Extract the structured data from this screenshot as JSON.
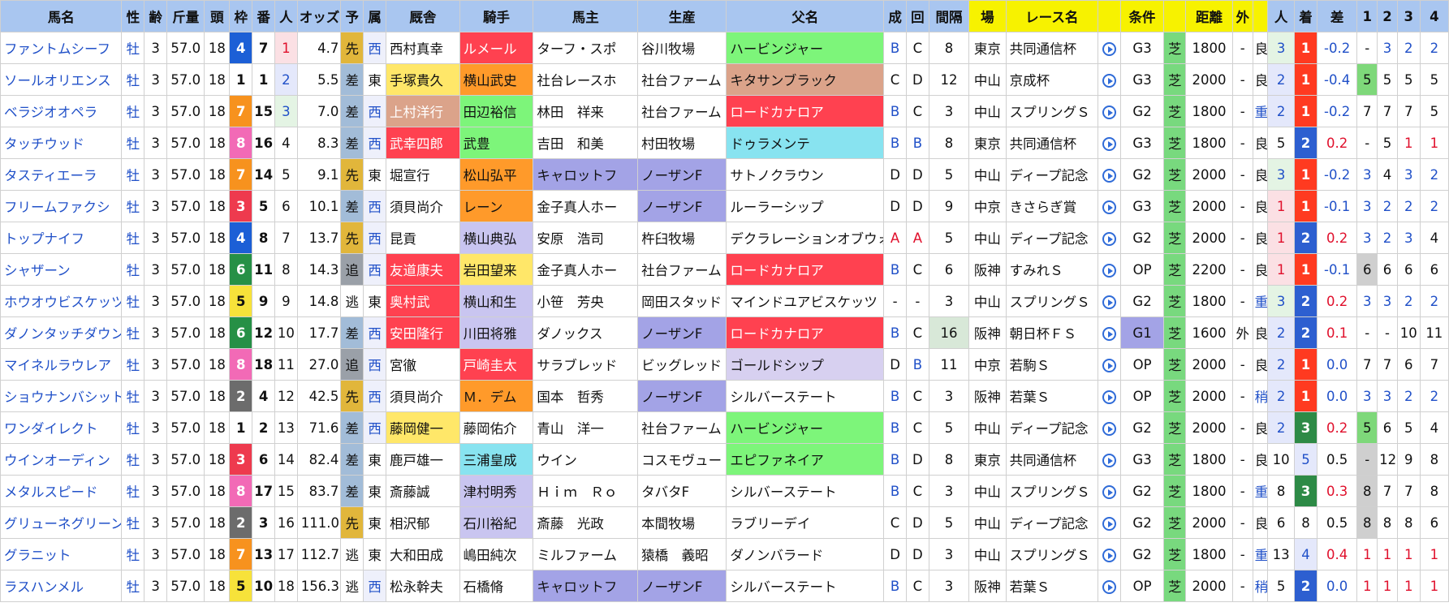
{
  "headers": [
    "馬名",
    "性",
    "齢",
    "斤量",
    "頭",
    "枠",
    "番",
    "人",
    "オッズ",
    "予",
    "属",
    "厩舎",
    "騎手",
    "馬主",
    "生産",
    "父名",
    "成",
    "回",
    "間隔",
    "場",
    "レース名",
    "",
    "条件",
    "",
    "距離",
    "外",
    "",
    "人",
    "着",
    "差",
    "1",
    "2",
    "3",
    "4"
  ],
  "colors": {
    "header": "#a9c6f0",
    "header_yellow": "#f7f200",
    "waku": {
      "1": "#ffffff",
      "2": "#6c6c6c",
      "3": "#ee3a4e",
      "4": "#1c5fd6",
      "5": "#f7e23a",
      "6": "#269046",
      "7": "#f7921e",
      "8": "#f26ab6"
    },
    "style": {
      "先": "#e1b63b",
      "差": "#a2bcd8",
      "追": "#9aa0a8",
      "逃": "#ffffff"
    },
    "group": {
      "G1": "#a3a3e6",
      "G2": "#ffffff",
      "G3": "#ffffff",
      "OP": "#ffffff"
    },
    "finish": {
      "1": "#ff3a20",
      "2": "#2d5fd0",
      "3": "#2d8a46",
      "4": "#ffffff",
      "5": "#ffffff",
      "8": "#ffffff"
    },
    "hl": {
      "red": "#ff4150",
      "orange": "#ff9a2a",
      "yellow": "#ffe769",
      "green": "#7df57a",
      "lavender": "#c9c5f0",
      "cyan": "#88e3f0",
      "purple": "#a3a3e6",
      "brown": "#dba38a",
      "gray": "#cfcfcf",
      "lightlav": "#d7d0f0"
    }
  },
  "rows": [
    {
      "name": "ファントムシーフ",
      "sex": "牡",
      "age": "3",
      "kin": "57.0",
      "tou": "18",
      "waku": "4",
      "ban": "7",
      "nin": "1",
      "odds": "4.7",
      "yo": "先",
      "zoku": "西",
      "kyusha": "西村真幸",
      "kishu": "ルメール",
      "banushi": "ターフ・スポ",
      "seisan": "谷川牧場",
      "chichi": "ハービンジャー",
      "sei": "B",
      "kai": "C",
      "kankaku": "8",
      "ba": "東京",
      "race": "共同通信杯",
      "joken": "G3",
      "shiba": "芝",
      "kyori": "1800",
      "soto": "-",
      "baba": "良",
      "rnin": "3",
      "chaku": "1",
      "sa": "-0.2",
      "c1": "-",
      "c2": "3",
      "c3": "2",
      "c4": "2",
      "kyusha_bg": "",
      "kishu_bg": "red",
      "banushi_bg": "",
      "seisan_bg": "",
      "chichi_bg": "green"
    },
    {
      "name": "ソールオリエンス",
      "sex": "牡",
      "age": "3",
      "kin": "57.0",
      "tou": "18",
      "waku": "1",
      "ban": "1",
      "nin": "2",
      "odds": "5.5",
      "yo": "差",
      "zoku": "東",
      "kyusha": "手塚貴久",
      "kishu": "横山武史",
      "banushi": "社台レースホ",
      "seisan": "社台ファーム",
      "chichi": "キタサンブラック",
      "sei": "C",
      "kai": "D",
      "kankaku": "12",
      "ba": "中山",
      "race": "京成杯",
      "joken": "G3",
      "shiba": "芝",
      "kyori": "2000",
      "soto": "-",
      "baba": "良",
      "rnin": "2",
      "chaku": "1",
      "sa": "-0.4",
      "c1": "5",
      "c2": "5",
      "c3": "5",
      "c4": "5",
      "kyusha_bg": "yellow",
      "kishu_bg": "orange",
      "banushi_bg": "",
      "seisan_bg": "",
      "chichi_bg": "brown"
    },
    {
      "name": "ベラジオオペラ",
      "sex": "牡",
      "age": "3",
      "kin": "57.0",
      "tou": "18",
      "waku": "7",
      "ban": "15",
      "nin": "3",
      "odds": "7.0",
      "yo": "差",
      "zoku": "西",
      "kyusha": "上村洋行",
      "kishu": "田辺裕信",
      "banushi": "林田　祥来",
      "seisan": "社台ファーム",
      "chichi": "ロードカナロア",
      "sei": "B",
      "kai": "C",
      "kankaku": "3",
      "ba": "中山",
      "race": "スプリングＳ",
      "joken": "G2",
      "shiba": "芝",
      "kyori": "1800",
      "soto": "-",
      "baba": "重",
      "rnin": "2",
      "chaku": "1",
      "sa": "-0.2",
      "c1": "7",
      "c2": "7",
      "c3": "7",
      "c4": "5",
      "kyusha_bg": "brown",
      "kishu_bg": "green",
      "banushi_bg": "",
      "seisan_bg": "",
      "chichi_bg": "red"
    },
    {
      "name": "タッチウッド",
      "sex": "牡",
      "age": "3",
      "kin": "57.0",
      "tou": "18",
      "waku": "8",
      "ban": "16",
      "nin": "4",
      "odds": "8.3",
      "yo": "差",
      "zoku": "西",
      "kyusha": "武幸四郎",
      "kishu": "武豊",
      "banushi": "吉田　和美",
      "seisan": "村田牧場",
      "chichi": "ドゥラメンテ",
      "sei": "B",
      "kai": "B",
      "kankaku": "8",
      "ba": "東京",
      "race": "共同通信杯",
      "joken": "G3",
      "shiba": "芝",
      "kyori": "1800",
      "soto": "-",
      "baba": "良",
      "rnin": "5",
      "chaku": "2",
      "sa": "0.2",
      "c1": "-",
      "c2": "5",
      "c3": "1",
      "c4": "1",
      "kyusha_bg": "red",
      "kishu_bg": "green",
      "banushi_bg": "",
      "seisan_bg": "",
      "chichi_bg": "cyan"
    },
    {
      "name": "タスティエーラ",
      "sex": "牡",
      "age": "3",
      "kin": "57.0",
      "tou": "18",
      "waku": "7",
      "ban": "14",
      "nin": "5",
      "odds": "9.1",
      "yo": "先",
      "zoku": "東",
      "kyusha": "堀宣行",
      "kishu": "松山弘平",
      "banushi": "キャロットフ",
      "seisan": "ノーザンF",
      "chichi": "サトノクラウン",
      "sei": "D",
      "kai": "D",
      "kankaku": "5",
      "ba": "中山",
      "race": "ディープ記念",
      "joken": "G2",
      "shiba": "芝",
      "kyori": "2000",
      "soto": "-",
      "baba": "良",
      "rnin": "3",
      "chaku": "1",
      "sa": "-0.2",
      "c1": "3",
      "c2": "4",
      "c3": "3",
      "c4": "2",
      "kyusha_bg": "",
      "kishu_bg": "orange",
      "banushi_bg": "purple",
      "seisan_bg": "purple",
      "chichi_bg": ""
    },
    {
      "name": "フリームファクシ",
      "sex": "牡",
      "age": "3",
      "kin": "57.0",
      "tou": "18",
      "waku": "3",
      "ban": "5",
      "nin": "6",
      "odds": "10.1",
      "yo": "差",
      "zoku": "西",
      "kyusha": "須貝尚介",
      "kishu": "レーン",
      "banushi": "金子真人ホー",
      "seisan": "ノーザンF",
      "chichi": "ルーラーシップ",
      "sei": "D",
      "kai": "D",
      "kankaku": "9",
      "ba": "中京",
      "race": "きさらぎ賞",
      "joken": "G3",
      "shiba": "芝",
      "kyori": "2000",
      "soto": "-",
      "baba": "良",
      "rnin": "1",
      "chaku": "1",
      "sa": "-0.1",
      "c1": "3",
      "c2": "2",
      "c3": "2",
      "c4": "2",
      "kyusha_bg": "",
      "kishu_bg": "orange",
      "banushi_bg": "",
      "seisan_bg": "purple",
      "chichi_bg": ""
    },
    {
      "name": "トップナイフ",
      "sex": "牡",
      "age": "3",
      "kin": "57.0",
      "tou": "18",
      "waku": "4",
      "ban": "8",
      "nin": "7",
      "odds": "13.7",
      "yo": "先",
      "zoku": "西",
      "kyusha": "昆貢",
      "kishu": "横山典弘",
      "banushi": "安原　浩司",
      "seisan": "杵臼牧場",
      "chichi": "デクラレーションオブウォー",
      "sei": "A",
      "kai": "A",
      "kankaku": "5",
      "ba": "中山",
      "race": "ディープ記念",
      "joken": "G2",
      "shiba": "芝",
      "kyori": "2000",
      "soto": "-",
      "baba": "良",
      "rnin": "1",
      "chaku": "2",
      "sa": "0.2",
      "c1": "3",
      "c2": "2",
      "c3": "3",
      "c4": "4",
      "kyusha_bg": "",
      "kishu_bg": "lavender",
      "banushi_bg": "",
      "seisan_bg": "",
      "chichi_bg": ""
    },
    {
      "name": "シャザーン",
      "sex": "牡",
      "age": "3",
      "kin": "57.0",
      "tou": "18",
      "waku": "6",
      "ban": "11",
      "nin": "8",
      "odds": "14.3",
      "yo": "追",
      "zoku": "西",
      "kyusha": "友道康夫",
      "kishu": "岩田望来",
      "banushi": "金子真人ホー",
      "seisan": "社台ファーム",
      "chichi": "ロードカナロア",
      "sei": "B",
      "kai": "C",
      "kankaku": "6",
      "ba": "阪神",
      "race": "すみれＳ",
      "joken": "OP",
      "shiba": "芝",
      "kyori": "2200",
      "soto": "-",
      "baba": "良",
      "rnin": "1",
      "chaku": "1",
      "sa": "-0.1",
      "c1": "6",
      "c2": "6",
      "c3": "6",
      "c4": "6",
      "kyusha_bg": "red",
      "kishu_bg": "yellow",
      "banushi_bg": "",
      "seisan_bg": "",
      "chichi_bg": "red"
    },
    {
      "name": "ホウオウビスケッツ",
      "sex": "牡",
      "age": "3",
      "kin": "57.0",
      "tou": "18",
      "waku": "5",
      "ban": "9",
      "nin": "9",
      "odds": "14.8",
      "yo": "逃",
      "zoku": "東",
      "kyusha": "奥村武",
      "kishu": "横山和生",
      "banushi": "小笹　芳央",
      "seisan": "岡田スタッド",
      "chichi": "マインドユアビスケッツ",
      "sei": "-",
      "kai": "-",
      "kankaku": "3",
      "ba": "中山",
      "race": "スプリングＳ",
      "joken": "G2",
      "shiba": "芝",
      "kyori": "1800",
      "soto": "-",
      "baba": "重",
      "rnin": "3",
      "chaku": "2",
      "sa": "0.2",
      "c1": "3",
      "c2": "3",
      "c3": "2",
      "c4": "2",
      "kyusha_bg": "red",
      "kishu_bg": "lavender",
      "banushi_bg": "",
      "seisan_bg": "",
      "chichi_bg": ""
    },
    {
      "name": "ダノンタッチダウン",
      "sex": "牡",
      "age": "3",
      "kin": "57.0",
      "tou": "18",
      "waku": "6",
      "ban": "12",
      "nin": "10",
      "odds": "17.7",
      "yo": "差",
      "zoku": "西",
      "kyusha": "安田隆行",
      "kishu": "川田将雅",
      "banushi": "ダノックス",
      "seisan": "ノーザンF",
      "chichi": "ロードカナロア",
      "sei": "B",
      "kai": "C",
      "kankaku": "16",
      "ba": "阪神",
      "race": "朝日杯ＦＳ",
      "joken": "G1",
      "shiba": "芝",
      "kyori": "1600",
      "soto": "外",
      "baba": "良",
      "rnin": "2",
      "chaku": "2",
      "sa": "0.1",
      "c1": "-",
      "c2": "-",
      "c3": "10",
      "c4": "11",
      "kyusha_bg": "red",
      "kishu_bg": "lavender",
      "banushi_bg": "",
      "seisan_bg": "purple",
      "chichi_bg": "red"
    },
    {
      "name": "マイネルラウレア",
      "sex": "牡",
      "age": "3",
      "kin": "57.0",
      "tou": "18",
      "waku": "8",
      "ban": "18",
      "nin": "11",
      "odds": "27.0",
      "yo": "追",
      "zoku": "西",
      "kyusha": "宮徹",
      "kishu": "戸崎圭太",
      "banushi": "サラブレッド",
      "seisan": "ビッグレッド",
      "chichi": "ゴールドシップ",
      "sei": "D",
      "kai": "B",
      "kankaku": "11",
      "ba": "中京",
      "race": "若駒Ｓ",
      "joken": "OP",
      "shiba": "芝",
      "kyori": "2000",
      "soto": "-",
      "baba": "良",
      "rnin": "2",
      "chaku": "1",
      "sa": "0.0",
      "c1": "7",
      "c2": "7",
      "c3": "6",
      "c4": "7",
      "kyusha_bg": "",
      "kishu_bg": "red",
      "banushi_bg": "",
      "seisan_bg": "",
      "chichi_bg": "lightlav"
    },
    {
      "name": "ショウナンバシット",
      "sex": "牡",
      "age": "3",
      "kin": "57.0",
      "tou": "18",
      "waku": "2",
      "ban": "4",
      "nin": "12",
      "odds": "42.5",
      "yo": "先",
      "zoku": "西",
      "kyusha": "須貝尚介",
      "kishu": "Ｍ．デム",
      "banushi": "国本　哲秀",
      "seisan": "ノーザンF",
      "chichi": "シルバーステート",
      "sei": "B",
      "kai": "C",
      "kankaku": "3",
      "ba": "阪神",
      "race": "若葉Ｓ",
      "joken": "OP",
      "shiba": "芝",
      "kyori": "2000",
      "soto": "-",
      "baba": "稍",
      "rnin": "2",
      "chaku": "1",
      "sa": "0.0",
      "c1": "3",
      "c2": "3",
      "c3": "2",
      "c4": "2",
      "kyusha_bg": "",
      "kishu_bg": "orange",
      "banushi_bg": "",
      "seisan_bg": "purple",
      "chichi_bg": ""
    },
    {
      "name": "ワンダイレクト",
      "sex": "牡",
      "age": "3",
      "kin": "57.0",
      "tou": "18",
      "waku": "1",
      "ban": "2",
      "nin": "13",
      "odds": "71.6",
      "yo": "差",
      "zoku": "西",
      "kyusha": "藤岡健一",
      "kishu": "藤岡佑介",
      "banushi": "青山　洋一",
      "seisan": "社台ファーム",
      "chichi": "ハービンジャー",
      "sei": "B",
      "kai": "C",
      "kankaku": "5",
      "ba": "中山",
      "race": "ディープ記念",
      "joken": "G2",
      "shiba": "芝",
      "kyori": "2000",
      "soto": "-",
      "baba": "良",
      "rnin": "2",
      "chaku": "3",
      "sa": "0.2",
      "c1": "5",
      "c2": "6",
      "c3": "5",
      "c4": "4",
      "kyusha_bg": "yellow",
      "kishu_bg": "",
      "banushi_bg": "",
      "seisan_bg": "",
      "chichi_bg": "green"
    },
    {
      "name": "ウインオーディン",
      "sex": "牡",
      "age": "3",
      "kin": "57.0",
      "tou": "18",
      "waku": "3",
      "ban": "6",
      "nin": "14",
      "odds": "82.4",
      "yo": "差",
      "zoku": "東",
      "kyusha": "鹿戸雄一",
      "kishu": "三浦皇成",
      "banushi": "ウイン",
      "seisan": "コスモヴュー",
      "chichi": "エピファネイア",
      "sei": "B",
      "kai": "D",
      "kankaku": "8",
      "ba": "東京",
      "race": "共同通信杯",
      "joken": "G3",
      "shiba": "芝",
      "kyori": "1800",
      "soto": "-",
      "baba": "良",
      "rnin": "10",
      "chaku": "5",
      "sa": "0.5",
      "c1": "-",
      "c2": "12",
      "c3": "9",
      "c4": "8",
      "kyusha_bg": "",
      "kishu_bg": "cyan",
      "banushi_bg": "",
      "seisan_bg": "",
      "chichi_bg": "green"
    },
    {
      "name": "メタルスピード",
      "sex": "牡",
      "age": "3",
      "kin": "57.0",
      "tou": "18",
      "waku": "8",
      "ban": "17",
      "nin": "15",
      "odds": "83.7",
      "yo": "差",
      "zoku": "東",
      "kyusha": "斎藤誠",
      "kishu": "津村明秀",
      "banushi": "Ｈｉｍ　Ｒｏ",
      "seisan": "タバタF",
      "chichi": "シルバーステート",
      "sei": "B",
      "kai": "C",
      "kankaku": "3",
      "ba": "中山",
      "race": "スプリングＳ",
      "joken": "G2",
      "shiba": "芝",
      "kyori": "1800",
      "soto": "-",
      "baba": "重",
      "rnin": "8",
      "chaku": "3",
      "sa": "0.3",
      "c1": "8",
      "c2": "7",
      "c3": "7",
      "c4": "8",
      "kyusha_bg": "",
      "kishu_bg": "lavender",
      "banushi_bg": "",
      "seisan_bg": "",
      "chichi_bg": ""
    },
    {
      "name": "グリューネグリーン",
      "sex": "牡",
      "age": "3",
      "kin": "57.0",
      "tou": "18",
      "waku": "2",
      "ban": "3",
      "nin": "16",
      "odds": "111.0",
      "yo": "先",
      "zoku": "東",
      "kyusha": "相沢郁",
      "kishu": "石川裕紀",
      "banushi": "斎藤　光政",
      "seisan": "本間牧場",
      "chichi": "ラブリーデイ",
      "sei": "C",
      "kai": "D",
      "kankaku": "5",
      "ba": "中山",
      "race": "ディープ記念",
      "joken": "G2",
      "shiba": "芝",
      "kyori": "2000",
      "soto": "-",
      "baba": "良",
      "rnin": "6",
      "chaku": "8",
      "sa": "0.5",
      "c1": "8",
      "c2": "8",
      "c3": "8",
      "c4": "6",
      "kyusha_bg": "",
      "kishu_bg": "lavender",
      "banushi_bg": "",
      "seisan_bg": "",
      "chichi_bg": ""
    },
    {
      "name": "グラニット",
      "sex": "牡",
      "age": "3",
      "kin": "57.0",
      "tou": "18",
      "waku": "7",
      "ban": "13",
      "nin": "17",
      "odds": "112.7",
      "yo": "逃",
      "zoku": "東",
      "kyusha": "大和田成",
      "kishu": "嶋田純次",
      "banushi": "ミルファーム",
      "seisan": "猿橋　義昭",
      "chichi": "ダノンバラード",
      "sei": "D",
      "kai": "D",
      "kankaku": "3",
      "ba": "中山",
      "race": "スプリングＳ",
      "joken": "G2",
      "shiba": "芝",
      "kyori": "1800",
      "soto": "-",
      "baba": "重",
      "rnin": "13",
      "chaku": "4",
      "sa": "0.4",
      "c1": "1",
      "c2": "1",
      "c3": "1",
      "c4": "1",
      "kyusha_bg": "",
      "kishu_bg": "",
      "banushi_bg": "",
      "seisan_bg": "",
      "chichi_bg": ""
    },
    {
      "name": "ラスハンメル",
      "sex": "牡",
      "age": "3",
      "kin": "57.0",
      "tou": "18",
      "waku": "5",
      "ban": "10",
      "nin": "18",
      "odds": "156.3",
      "yo": "逃",
      "zoku": "西",
      "kyusha": "松永幹夫",
      "kishu": "石橋脩",
      "banushi": "キャロットフ",
      "seisan": "ノーザンF",
      "chichi": "シルバーステート",
      "sei": "B",
      "kai": "C",
      "kankaku": "3",
      "ba": "阪神",
      "race": "若葉Ｓ",
      "joken": "OP",
      "shiba": "芝",
      "kyori": "2000",
      "soto": "-",
      "baba": "稍",
      "rnin": "5",
      "chaku": "2",
      "sa": "0.0",
      "c1": "1",
      "c2": "1",
      "c3": "1",
      "c4": "1",
      "kyusha_bg": "",
      "kishu_bg": "",
      "banushi_bg": "purple",
      "seisan_bg": "purple",
      "chichi_bg": ""
    }
  ]
}
